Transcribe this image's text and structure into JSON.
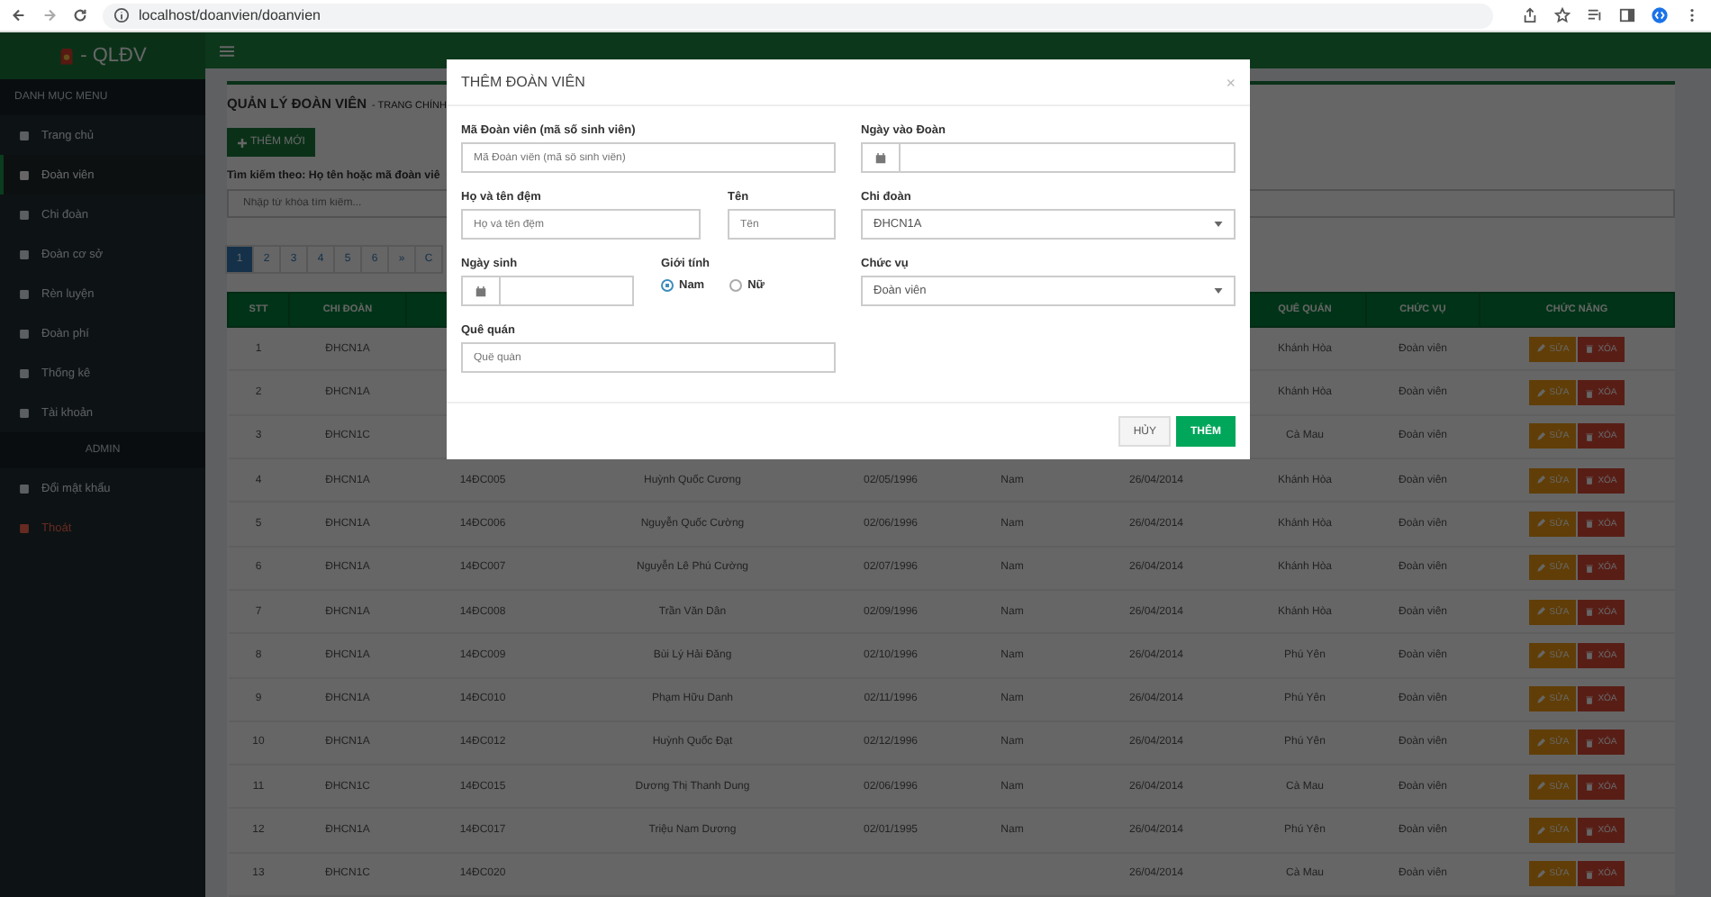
{
  "browser": {
    "url": "localhost/doanvien/doanvien"
  },
  "app_header": {
    "brand": "- QLĐV"
  },
  "sidebar": {
    "groups": [
      {
        "heading": "DANH MỤC MENU",
        "items": [
          {
            "label": "Trang chủ",
            "selected": false,
            "kind": "normal"
          },
          {
            "label": "Đoàn viên",
            "selected": true,
            "kind": "normal"
          },
          {
            "label": "Chi đoàn",
            "selected": false,
            "kind": "normal"
          },
          {
            "label": "Đoàn cơ sở",
            "selected": false,
            "kind": "normal"
          },
          {
            "label": "Rèn luyện",
            "selected": false,
            "kind": "normal"
          },
          {
            "label": "Đoàn phí",
            "selected": false,
            "kind": "normal"
          },
          {
            "label": "Thống kê",
            "selected": false,
            "kind": "normal"
          },
          {
            "label": "Tài khoản",
            "selected": false,
            "kind": "normal"
          }
        ]
      },
      {
        "heading": "ADMIN",
        "items": [
          {
            "label": "Đổi mật khẩu",
            "selected": false,
            "kind": "normal"
          },
          {
            "label": "Thoát",
            "selected": false,
            "kind": "logout"
          }
        ]
      }
    ]
  },
  "page": {
    "title": "QUẢN LÝ ĐOÀN VIÊN",
    "subtitle": "- TRANG CHÍNH",
    "add_button": "THÊM MỚI",
    "search_label": "Tìm kiếm theo: Họ tên hoặc mã đoàn viê",
    "search_placeholder": "Nhập từ khóa tìm kiếm...",
    "pagination": [
      {
        "label": "1",
        "selected": true
      },
      {
        "label": "2",
        "selected": false
      },
      {
        "label": "3",
        "selected": false
      },
      {
        "label": "4",
        "selected": false
      },
      {
        "label": "5",
        "selected": false
      },
      {
        "label": "6",
        "selected": false
      },
      {
        "label": "»",
        "selected": false
      },
      {
        "label": "C",
        "selected": false
      }
    ]
  },
  "table": {
    "columns": {
      "stt": "STT",
      "chi_doan": "CHI ĐOÀN",
      "que_quan": "QUÊ QUÁN",
      "chuc_vu": "CHỨC VỤ",
      "chuc_nang": "CHỨC NĂNG"
    },
    "rows": [
      {
        "stt": "1",
        "chi_doan": "ĐHCN1A",
        "que_quan": "Khánh Hòa",
        "chuc_vu": "Đoàn viên",
        "edit": "SỬA",
        "delete": "XÓA"
      },
      {
        "stt": "2",
        "chi_doan": "ĐHCN1A",
        "que_quan": "Khánh Hòa",
        "chuc_vu": "Đoàn viên",
        "edit": "SỬA",
        "delete": "XÓA"
      },
      {
        "stt": "3",
        "chi_doan": "ĐHCN1C",
        "que_quan": "Cà Mau",
        "chuc_vu": "Đoàn viên",
        "edit": "SỬA",
        "delete": "XÓA"
      },
      {
        "stt": "4",
        "chi_doan": "ĐHCN1A",
        "column_3": "14ĐC005",
        "column_4": "Huỳnh Quốc Cương",
        "column_5": "02/05/1996",
        "column_6": "Nam",
        "column_7": "26/04/2014",
        "que_quan": "Khánh Hòa",
        "chuc_vu": "Đoàn viên",
        "edit": "SỬA",
        "delete": "XÓA"
      },
      {
        "stt": "5",
        "chi_doan": "ĐHCN1A",
        "column_3": "14ĐC006",
        "column_4": "Nguyễn Quốc Cường",
        "column_5": "02/06/1996",
        "column_6": "Nam",
        "column_7": "26/04/2014",
        "que_quan": "Khánh Hòa",
        "chuc_vu": "Đoàn viên",
        "edit": "SỬA",
        "delete": "XÓA"
      },
      {
        "stt": "6",
        "chi_doan": "ĐHCN1A",
        "column_3": "14ĐC007",
        "column_4": "Nguyễn Lê Phú Cường",
        "column_5": "02/07/1996",
        "column_6": "Nam",
        "column_7": "26/04/2014",
        "que_quan": "Khánh Hòa",
        "chuc_vu": "Đoàn viên",
        "edit": "SỬA",
        "delete": "XÓA"
      },
      {
        "stt": "7",
        "chi_doan": "ĐHCN1A",
        "column_3": "14ĐC008",
        "column_4": "Trần Văn Dân",
        "column_5": "02/09/1996",
        "column_6": "Nam",
        "column_7": "26/04/2014",
        "que_quan": "Khánh Hòa",
        "chuc_vu": "Đoàn viên",
        "edit": "SỬA",
        "delete": "XÓA"
      },
      {
        "stt": "8",
        "chi_doan": "ĐHCN1A",
        "column_3": "14ĐC009",
        "column_4": "Bùi Lý Hải Đăng",
        "column_5": "02/10/1996",
        "column_6": "Nam",
        "column_7": "26/04/2014",
        "que_quan": "Phú Yên",
        "chuc_vu": "Đoàn viên",
        "edit": "SỬA",
        "delete": "XÓA"
      },
      {
        "stt": "9",
        "chi_doan": "ĐHCN1A",
        "column_3": "14ĐC010",
        "column_4": "Phạm Hữu Danh",
        "column_5": "02/11/1996",
        "column_6": "Nam",
        "column_7": "26/04/2014",
        "que_quan": "Phú Yên",
        "chuc_vu": "Đoàn viên",
        "edit": "SỬA",
        "delete": "XÓA"
      },
      {
        "stt": "10",
        "chi_doan": "ĐHCN1A",
        "column_3": "14ĐC012",
        "column_4": "Huỳnh Quốc Đạt",
        "column_5": "02/12/1996",
        "column_6": "Nam",
        "column_7": "26/04/2014",
        "que_quan": "Phú Yên",
        "chuc_vu": "Đoàn viên",
        "edit": "SỬA",
        "delete": "XÓA"
      },
      {
        "stt": "11",
        "chi_doan": "ĐHCN1C",
        "column_3": "14ĐC015",
        "column_4": "Dương Thị Thanh Dung",
        "column_5": "02/06/1996",
        "column_6": "Nam",
        "column_7": "26/04/2014",
        "que_quan": "Cà Mau",
        "chuc_vu": "Đoàn viên",
        "edit": "SỬA",
        "delete": "XÓA"
      },
      {
        "stt": "12",
        "chi_doan": "ĐHCN1A",
        "column_3": "14ĐC017",
        "column_4": "Triệu Nam Dương",
        "column_5": "02/01/1995",
        "column_6": "Nam",
        "column_7": "26/04/2014",
        "que_quan": "Phú Yên",
        "chuc_vu": "Đoàn viên",
        "edit": "SỬA",
        "delete": "XÓA"
      },
      {
        "stt": "13",
        "chi_doan": "ĐHCN1C",
        "column_3": "14ĐC020",
        "column_7": "26/04/2014",
        "que_quan": "Cà Mau",
        "chuc_vu": "Đoàn viên",
        "edit": "SỬA",
        "delete": "XÓA"
      }
    ]
  },
  "modal": {
    "title": "THÊM ĐOÀN VIÊN",
    "close": "×",
    "fields": {
      "ma_doan_vien": {
        "label": "Mã Đoàn viên (mã số sinh viên)",
        "placeholder": "Mã Đoàn viên (mã số sinh viên)"
      },
      "ngay_vao_doan": {
        "label": "Ngày vào Đoàn"
      },
      "ho_ten_dem": {
        "label": "Họ và tên đệm",
        "placeholder": "Họ và tên đệm"
      },
      "ten": {
        "label": "Tên",
        "placeholder": "Tên"
      },
      "chi_doan": {
        "label": "Chi đoàn",
        "value": "ĐHCN1A"
      },
      "ngay_sinh": {
        "label": "Ngày sinh"
      },
      "gioi_tinh": {
        "label": "Giới tính",
        "options": [
          {
            "label": "Nam",
            "selected": true
          },
          {
            "label": "Nữ",
            "selected": false
          }
        ]
      },
      "chuc_vu": {
        "label": "Chức vụ",
        "value": "Đoàn viên"
      },
      "que_quan": {
        "label": "Quê quán",
        "placeholder": "Quê quán"
      }
    },
    "cancel": "HỦY",
    "submit": "THÊM"
  }
}
